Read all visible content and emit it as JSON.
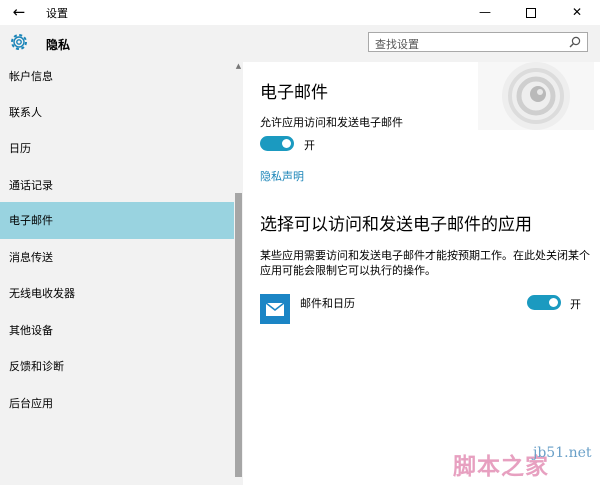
{
  "window": {
    "title": "设置",
    "back_glyph": "←",
    "minimize_glyph": "—",
    "close_glyph": "✕"
  },
  "header": {
    "title": "隐私",
    "search_placeholder": "查找设置"
  },
  "sidebar": {
    "items": [
      {
        "label": "帐户信息"
      },
      {
        "label": "联系人"
      },
      {
        "label": "日历"
      },
      {
        "label": "通话记录"
      },
      {
        "label": "电子邮件"
      },
      {
        "label": "消息传送"
      },
      {
        "label": "无线电收发器"
      },
      {
        "label": "其他设备"
      },
      {
        "label": "反馈和诊断"
      },
      {
        "label": "后台应用"
      }
    ],
    "active_index": 4,
    "scroll_up_glyph": "▲"
  },
  "main": {
    "title": "电子邮件",
    "allow_label": "允许应用访问和发送电子邮件",
    "allow_toggle_state": "开",
    "privacy_link": "隐私声明",
    "section_title": "选择可以访问和发送电子邮件的应用",
    "section_desc": "某些应用需要访问和发送电子邮件才能按预期工作。在此处关闭某个应用可能会限制它可以执行的操作。",
    "apps": [
      {
        "name": "邮件和日历",
        "toggle_state": "开"
      }
    ]
  },
  "watermark": {
    "site": "jb51.net",
    "brand": "脚本之家"
  },
  "colors": {
    "accent": "#1b9ac0",
    "active_nav": "#99d3e0",
    "sidebar_bg": "#f2f2f2"
  }
}
